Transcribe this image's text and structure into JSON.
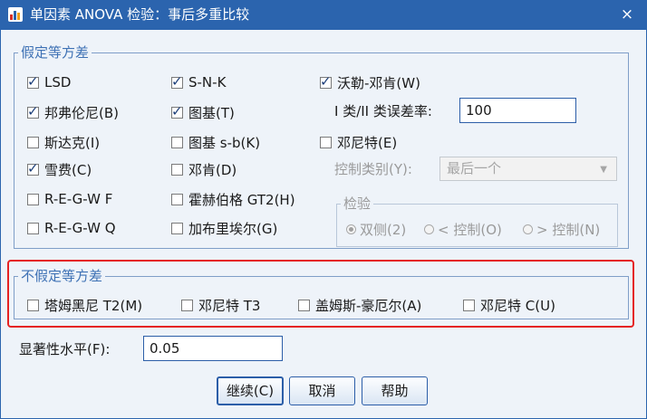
{
  "window": {
    "title": "单因素 ANOVA 检验：事后多重比较",
    "close_glyph": "×"
  },
  "equal_variance": {
    "legend": "假定等方差",
    "options": [
      {
        "label": "LSD",
        "key": "L",
        "checked": true
      },
      {
        "label": "S-N-K",
        "key": "S",
        "checked": true
      },
      {
        "label": "沃勒-邓肯(W)",
        "key": "W",
        "checked": true
      },
      {
        "label": "邦弗伦尼(B)",
        "key": "B",
        "checked": true
      },
      {
        "label": "图基(T)",
        "key": "T",
        "checked": true
      },
      {
        "label": "斯达克(I)",
        "key": "I",
        "checked": false
      },
      {
        "label": "图基 s-b(K)",
        "key": "K",
        "checked": false
      },
      {
        "label": "邓尼特(E)",
        "key": "E",
        "checked": false
      },
      {
        "label": "雪费(C)",
        "key": "C",
        "checked": true
      },
      {
        "label": "邓肯(D)",
        "key": "D",
        "checked": false
      },
      {
        "label": "R-E-G-W F",
        "key": "R",
        "checked": false
      },
      {
        "label": "霍赫伯格 GT2(H)",
        "key": "H",
        "checked": false
      },
      {
        "label": "R-E-G-W Q",
        "key": "Q",
        "checked": false
      },
      {
        "label": "加布里埃尔(G)",
        "key": "G",
        "checked": false
      }
    ],
    "error_ratio_label": "I 类/II 类误差率:",
    "error_ratio_value": "100",
    "control_label": "控制类别(Y):",
    "control_value": "最后一个",
    "test": {
      "legend": "检验",
      "options": [
        "双侧(2)",
        "< 控制(O)",
        "> 控制(N)"
      ],
      "selected": 0
    }
  },
  "unequal_variance": {
    "legend": "不假定等方差",
    "options": [
      {
        "label": "塔姆黑尼 T2(M)",
        "checked": false
      },
      {
        "label": "邓尼特 T3",
        "checked": false
      },
      {
        "label": "盖姆斯-豪厄尔(A)",
        "checked": false
      },
      {
        "label": "邓尼特 C(U)",
        "checked": false
      }
    ]
  },
  "significance": {
    "label": "显著性水平(F):",
    "value": "0.05"
  },
  "buttons": {
    "continue": "继续(C)",
    "cancel": "取消",
    "help": "帮助"
  },
  "colors": {
    "title_bar": "#2b64ae",
    "highlight": "#e52222",
    "legend": "#3f72b5"
  }
}
